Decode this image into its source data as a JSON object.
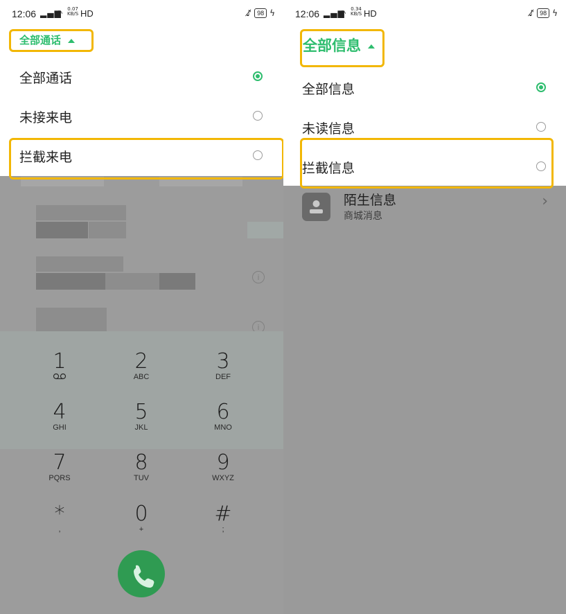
{
  "left": {
    "status": {
      "time": "12:06",
      "signal": "4G",
      "speed_value": "0.07",
      "speed_unit": "KB/S",
      "hd": "HD",
      "battery": "98"
    },
    "filter_title": "全部通话",
    "options": [
      {
        "label": "全部通话",
        "selected": true
      },
      {
        "label": "未接来电",
        "selected": false
      },
      {
        "label": "拦截来电",
        "selected": false
      }
    ],
    "keypad": [
      {
        "digit": "1",
        "sub": "voicemail-icon"
      },
      {
        "digit": "2",
        "sub": "ABC"
      },
      {
        "digit": "3",
        "sub": "DEF"
      },
      {
        "digit": "4",
        "sub": "GHI"
      },
      {
        "digit": "5",
        "sub": "JKL"
      },
      {
        "digit": "6",
        "sub": "MNO"
      },
      {
        "digit": "7",
        "sub": "PQRS"
      },
      {
        "digit": "8",
        "sub": "TUV"
      },
      {
        "digit": "9",
        "sub": "WXYZ"
      },
      {
        "digit": "*",
        "sub": ","
      },
      {
        "digit": "0",
        "sub": "+"
      },
      {
        "digit": "#",
        "sub": ";"
      }
    ],
    "call_icon": "phone-icon"
  },
  "right": {
    "status": {
      "time": "12:06",
      "signal": "4G",
      "speed_value": "0.34",
      "speed_unit": "KB/S",
      "hd": "HD",
      "battery": "98"
    },
    "filter_title": "全部信息",
    "options": [
      {
        "label": "全部信息",
        "selected": true
      },
      {
        "label": "未读信息",
        "selected": false
      },
      {
        "label": "拦截信息",
        "selected": false
      }
    ],
    "stranger": {
      "title": "陌生信息",
      "subtitle": "商城消息"
    }
  },
  "colors": {
    "accent": "#2ebd6e",
    "highlight": "#f2b705",
    "call": "#2f9b52",
    "overlay": "#9a9a9a"
  }
}
